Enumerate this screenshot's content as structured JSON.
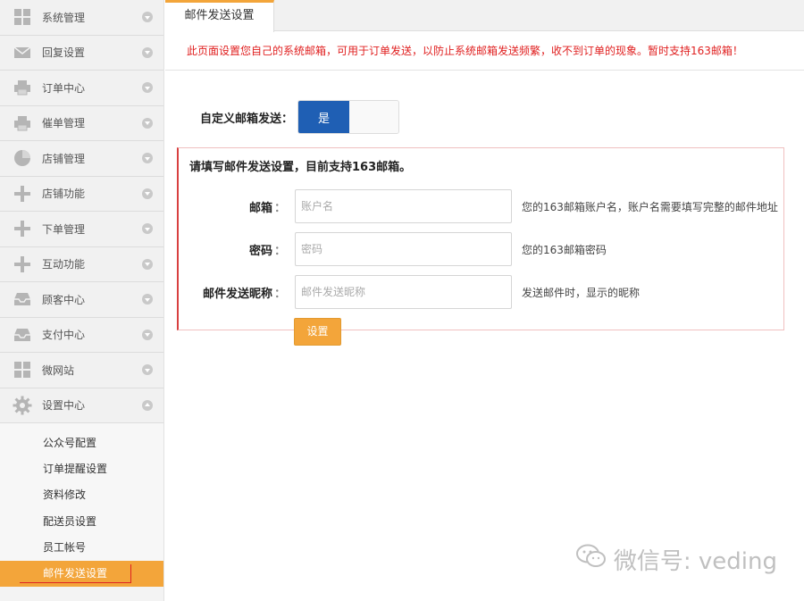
{
  "sidebar": {
    "items": [
      {
        "label": "系统管理",
        "icon": "grid-icon"
      },
      {
        "label": "回复设置",
        "icon": "envelope-icon"
      },
      {
        "label": "订单中心",
        "icon": "printer-icon"
      },
      {
        "label": "催单管理",
        "icon": "printer-icon"
      },
      {
        "label": "店铺管理",
        "icon": "pie-chart-icon"
      },
      {
        "label": "店铺功能",
        "icon": "plus-icon"
      },
      {
        "label": "下单管理",
        "icon": "plus-icon"
      },
      {
        "label": "互动功能",
        "icon": "plus-icon"
      },
      {
        "label": "顾客中心",
        "icon": "inbox-icon"
      },
      {
        "label": "支付中心",
        "icon": "inbox-icon"
      },
      {
        "label": "微网站",
        "icon": "grid-icon"
      },
      {
        "label": "设置中心",
        "icon": "gear-icon"
      }
    ],
    "subitems": [
      {
        "label": "公众号配置"
      },
      {
        "label": "订单提醒设置"
      },
      {
        "label": "资料修改"
      },
      {
        "label": "配送员设置"
      },
      {
        "label": "员工帐号"
      },
      {
        "label": "邮件发送设置"
      }
    ]
  },
  "header": {
    "tab_label": "邮件发送设置",
    "notice": "此页面设置您自己的系统邮箱，可用于订单发送，以防止系统邮箱发送频繁，收不到订单的现象。暂时支持163邮箱！"
  },
  "toggle": {
    "label": "自定义邮箱发送：",
    "on_label": "是"
  },
  "form": {
    "title": "请填写邮件发送设置，目前支持163邮箱。",
    "fields": [
      {
        "label": "邮箱",
        "colon": "：",
        "placeholder": "账户名",
        "hint": "您的163邮箱账户名，账户名需要填写完整的邮件地址"
      },
      {
        "label": "密码",
        "colon": "：",
        "placeholder": "密码",
        "hint": "您的163邮箱密码"
      },
      {
        "label": "邮件发送昵称",
        "colon": "：",
        "placeholder": "邮件发送昵称",
        "hint": "发送邮件时，显示的昵称"
      }
    ],
    "submit_label": "设置"
  },
  "watermark": {
    "text": "微信号: veding"
  },
  "colors": {
    "accent": "#f3a53a",
    "notice": "#e02020",
    "toggle_on": "#1f5fb4"
  }
}
